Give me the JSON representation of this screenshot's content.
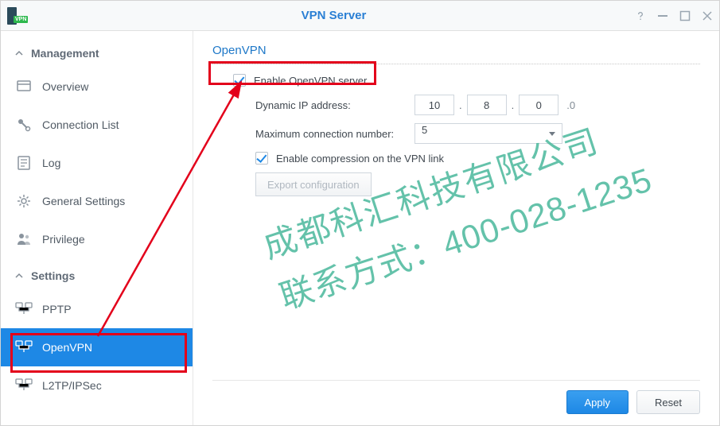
{
  "titlebar": {
    "title": "VPN Server",
    "app_badge": "VPN"
  },
  "sidebar": {
    "sections": [
      {
        "label": "Management"
      },
      {
        "label": "Settings"
      }
    ],
    "management_items": [
      {
        "label": "Overview"
      },
      {
        "label": "Connection List"
      },
      {
        "label": "Log"
      },
      {
        "label": "General Settings"
      },
      {
        "label": "Privilege"
      }
    ],
    "settings_items": [
      {
        "label": "PPTP"
      },
      {
        "label": "OpenVPN"
      },
      {
        "label": "L2TP/IPSec"
      }
    ]
  },
  "panel": {
    "title": "OpenVPN",
    "enable_label": "Enable OpenVPN server",
    "enable_checked": true,
    "dynamic_ip_label": "Dynamic IP address:",
    "ip": {
      "a": "10",
      "b": "8",
      "c": "0",
      "fixed": ".0"
    },
    "max_conn_label": "Maximum connection number:",
    "max_conn_value": "5",
    "compression_label": "Enable compression on the VPN link",
    "compression_checked": true,
    "export_label": "Export configuration"
  },
  "footer": {
    "apply": "Apply",
    "reset": "Reset"
  },
  "watermark": {
    "line1": "成都科汇科技有限公司",
    "line2": "联系方式：400-028-1235"
  }
}
